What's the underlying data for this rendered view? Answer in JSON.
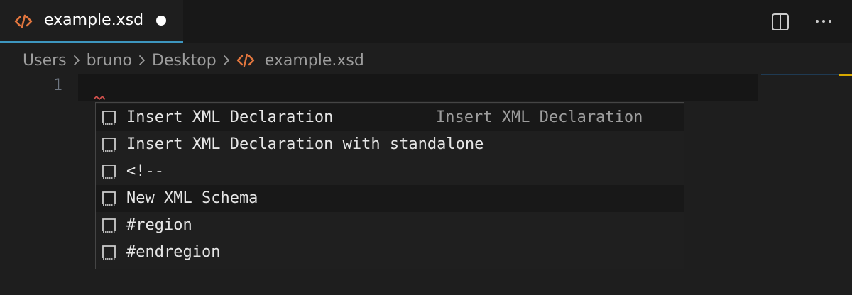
{
  "tab": {
    "icon": "xml-code-icon",
    "label": "example.xsd",
    "dirty": true
  },
  "actions": {
    "split_icon": "split-editor-icon",
    "more_icon": "more-actions-icon"
  },
  "breadcrumb": {
    "items": [
      "Users",
      "bruno",
      "Desktop"
    ],
    "file_icon": "xml-code-icon",
    "file": "example.xsd"
  },
  "editor": {
    "line_number": "1"
  },
  "suggest": {
    "items": [
      {
        "label": "Insert XML Declaration",
        "detail": "Insert XML Declaration",
        "icon": "snippet-icon"
      },
      {
        "label": "Insert XML Declaration with standalone",
        "detail": "",
        "icon": "snippet-icon"
      },
      {
        "label": "<!--",
        "detail": "",
        "icon": "snippet-icon"
      },
      {
        "label": "New XML Schema",
        "detail": "",
        "icon": "snippet-icon"
      },
      {
        "label": "#region",
        "detail": "",
        "icon": "snippet-icon"
      },
      {
        "label": "#endregion",
        "detail": "",
        "icon": "snippet-icon"
      }
    ]
  },
  "colors": {
    "accent": "#3d96bf",
    "xml_icon": "#e2763e",
    "background": "#1e1e1e"
  }
}
